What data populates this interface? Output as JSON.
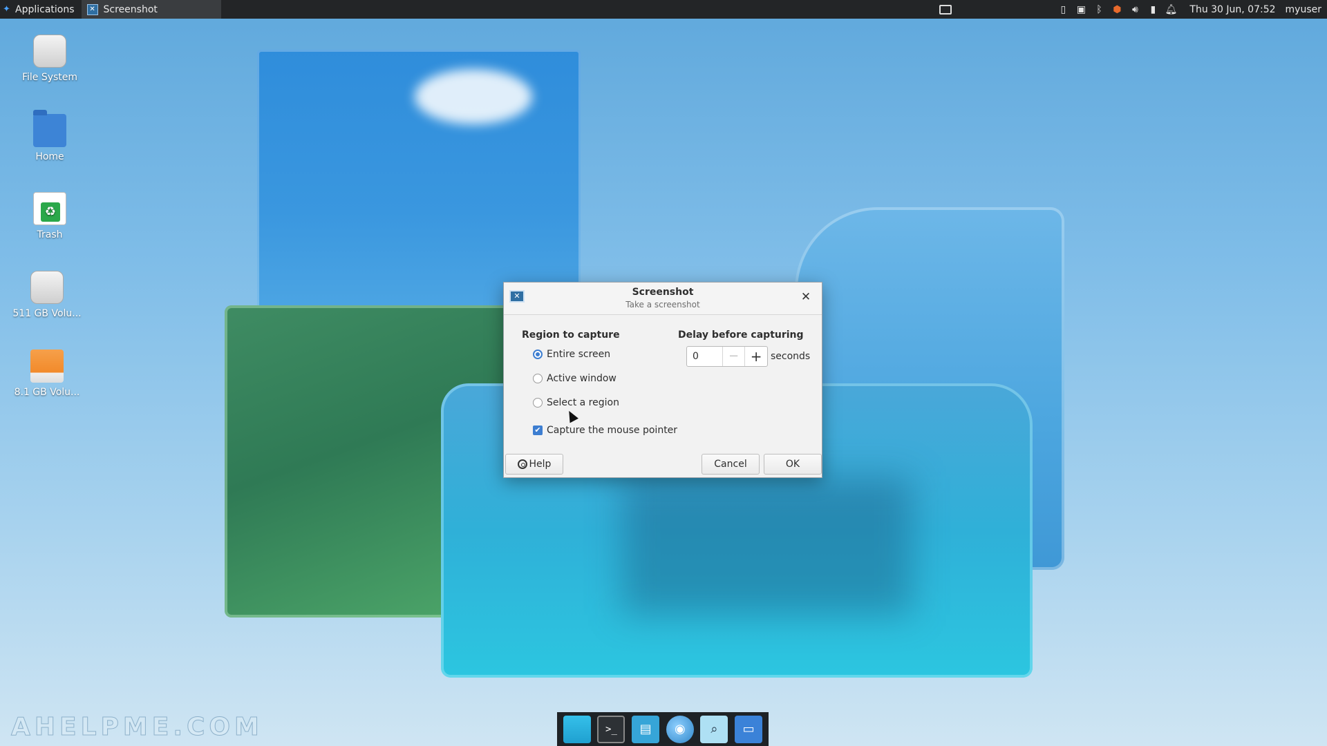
{
  "top_panel": {
    "applications_label": "Applications",
    "active_task_label": "Screenshot",
    "clock": "Thu 30 Jun, 07:52",
    "username": "myuser"
  },
  "desktop_icons": [
    {
      "label": "File System",
      "icon": "drive-icon"
    },
    {
      "label": "Home",
      "icon": "home-folder-icon"
    },
    {
      "label": "Trash",
      "icon": "trash-icon"
    },
    {
      "label": "511 GB Volu...",
      "icon": "drive-icon"
    },
    {
      "label": "8.1 GB Volu...",
      "icon": "usb-drive-icon"
    }
  ],
  "watermark": "AHELPME.COM",
  "dialog": {
    "title": "Screenshot",
    "subtitle": "Take a screenshot",
    "region_heading": "Region to capture",
    "region_options": [
      "Entire screen",
      "Active window",
      "Select a region"
    ],
    "selected_region": "Entire screen",
    "capture_pointer_label": "Capture the mouse pointer",
    "capture_pointer_checked": true,
    "delay_heading": "Delay before capturing",
    "delay_value": "0",
    "delay_units": "seconds",
    "help_label": "Help",
    "cancel_label": "Cancel",
    "ok_label": "OK"
  },
  "colors": {
    "accent": "#3d7ed1",
    "panel_bg": "#232527",
    "dialog_bg": "#f2f2f2"
  }
}
